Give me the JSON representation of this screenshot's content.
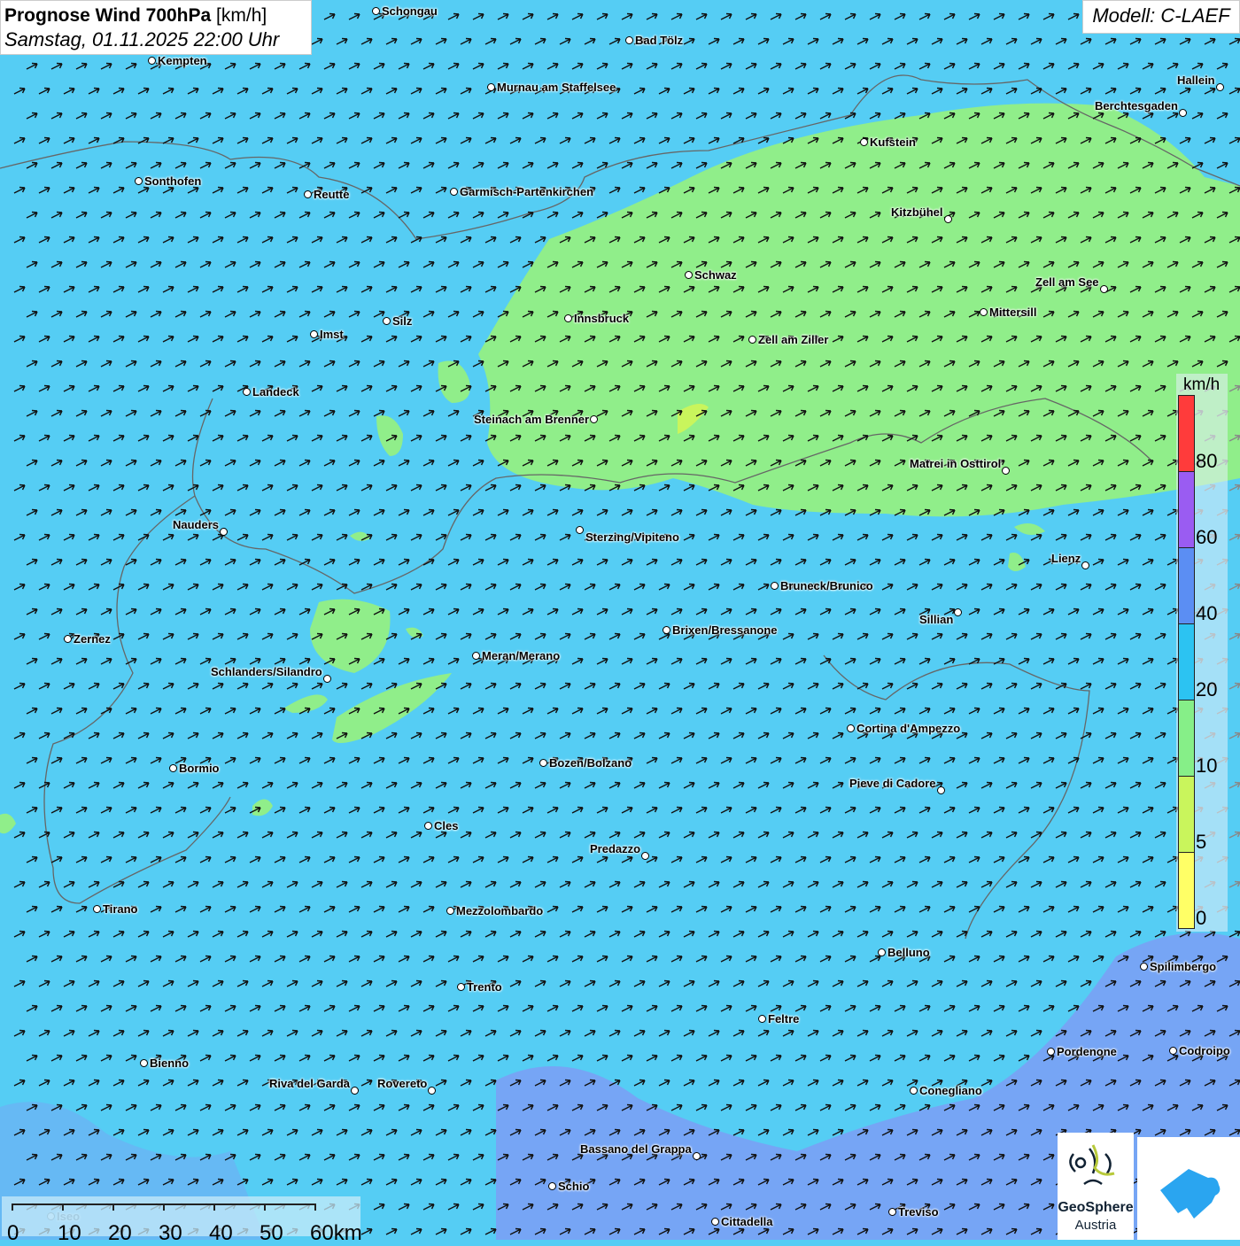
{
  "header": {
    "title_bold": "Prognose Wind 700hPa",
    "title_unit": "[km/h]",
    "subtitle": "Samstag, 01.11.2025 22:00 Uhr"
  },
  "model": {
    "label": "Modell: C-LAEF"
  },
  "colors": {
    "background": "#55cdf4",
    "calm": "#90ee8a",
    "strong": "#7f9cf5",
    "arrow": "#111111"
  },
  "legend": {
    "unit": "km/h",
    "bins": [
      {
        "color": "#ff3b3b",
        "label": "80"
      },
      {
        "color": "#9a5cf2",
        "label": "60"
      },
      {
        "color": "#5b8ef3",
        "label": "40"
      },
      {
        "color": "#2cc3f2",
        "label": "20"
      },
      {
        "color": "#86ef88",
        "label": "10"
      },
      {
        "color": "#c9f55c",
        "label": "5"
      },
      {
        "color": "#ffff66",
        "label": "0"
      }
    ]
  },
  "cities": [
    "Schongau",
    "Bad Tölz",
    "Kempten",
    "Murnau am Staffelsee",
    "Hallein",
    "Berchtesgaden",
    "Kufstein",
    "Sonthofen",
    "Reutte",
    "Garmisch-Partenkirchen",
    "Kitzbühel",
    "Schwaz",
    "Zell am See",
    "Innsbruck",
    "Mittersill",
    "Silz",
    "Imst",
    "Zell am Ziller",
    "Landeck",
    "Steinach am Brenner",
    "Matrei in Osttirol",
    "Nauders",
    "Sterzing/Vipiteno",
    "Lienz",
    "Bruneck/Brunico",
    "Sillian",
    "Brixen/Bressanone",
    "Zernez",
    "Meran/Merano",
    "Schlanders/Silandro",
    "Cortina d'Ampezzo",
    "Bozen/Bolzano",
    "Bormio",
    "Pieve di Cadore",
    "Cles",
    "Predazzo",
    "Tirano",
    "Mezzolombardo",
    "Belluno",
    "Spilimbergo",
    "Trento",
    "Feltre",
    "Pordenone",
    "Codroipo",
    "Bienno",
    "Riva del Garda",
    "Rovereto",
    "Conegliano",
    "Bassano del Grappa",
    "Schio",
    "Treviso",
    "Cittadella",
    "Iseo"
  ],
  "scale": {
    "labels": [
      "0",
      "10",
      "20",
      "30",
      "40",
      "50",
      "60km"
    ]
  },
  "logos": {
    "geosphere_line1": "GeoSphere",
    "geosphere_line2": "Austria"
  }
}
